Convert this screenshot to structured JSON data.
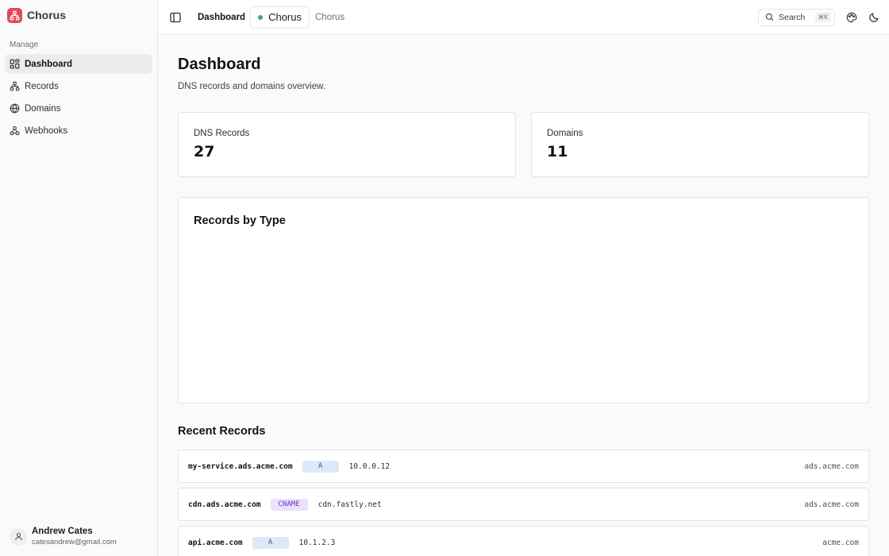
{
  "app": {
    "name": "Chorus",
    "brand_color": "#e2495b"
  },
  "sidebar": {
    "section_label": "Manage",
    "items": [
      {
        "label": "Dashboard",
        "icon": "grid-icon",
        "active": true
      },
      {
        "label": "Records",
        "icon": "network-icon",
        "active": false
      },
      {
        "label": "Domains",
        "icon": "globe-icon",
        "active": false
      },
      {
        "label": "Webhooks",
        "icon": "webhook-icon",
        "active": false
      }
    ],
    "user": {
      "name": "Andrew Cates",
      "email": "catesandrew@gmail.com"
    }
  },
  "topbar": {
    "current_page": "Dashboard",
    "project_tab": "Chorus",
    "project_status_color": "#3aa77b",
    "project_crumb": "Chorus",
    "search_label": "Search",
    "search_shortcut": "⌘K"
  },
  "page": {
    "title": "Dashboard",
    "subtitle": "DNS records and domains overview."
  },
  "stats": [
    {
      "label": "DNS Records",
      "value": "27"
    },
    {
      "label": "Domains",
      "value": "11"
    }
  ],
  "chart_card": {
    "title": "Records by Type"
  },
  "recent": {
    "title": "Recent Records",
    "rows": [
      {
        "name": "my-service.ads.acme.com",
        "type": "A",
        "value": "10.0.0.12",
        "domain": "ads.acme.com"
      },
      {
        "name": "cdn.ads.acme.com",
        "type": "CNAME",
        "value": "cdn.fastly.net",
        "domain": "ads.acme.com"
      },
      {
        "name": "api.acme.com",
        "type": "A",
        "value": "10.1.2.3",
        "domain": "acme.com"
      }
    ]
  }
}
